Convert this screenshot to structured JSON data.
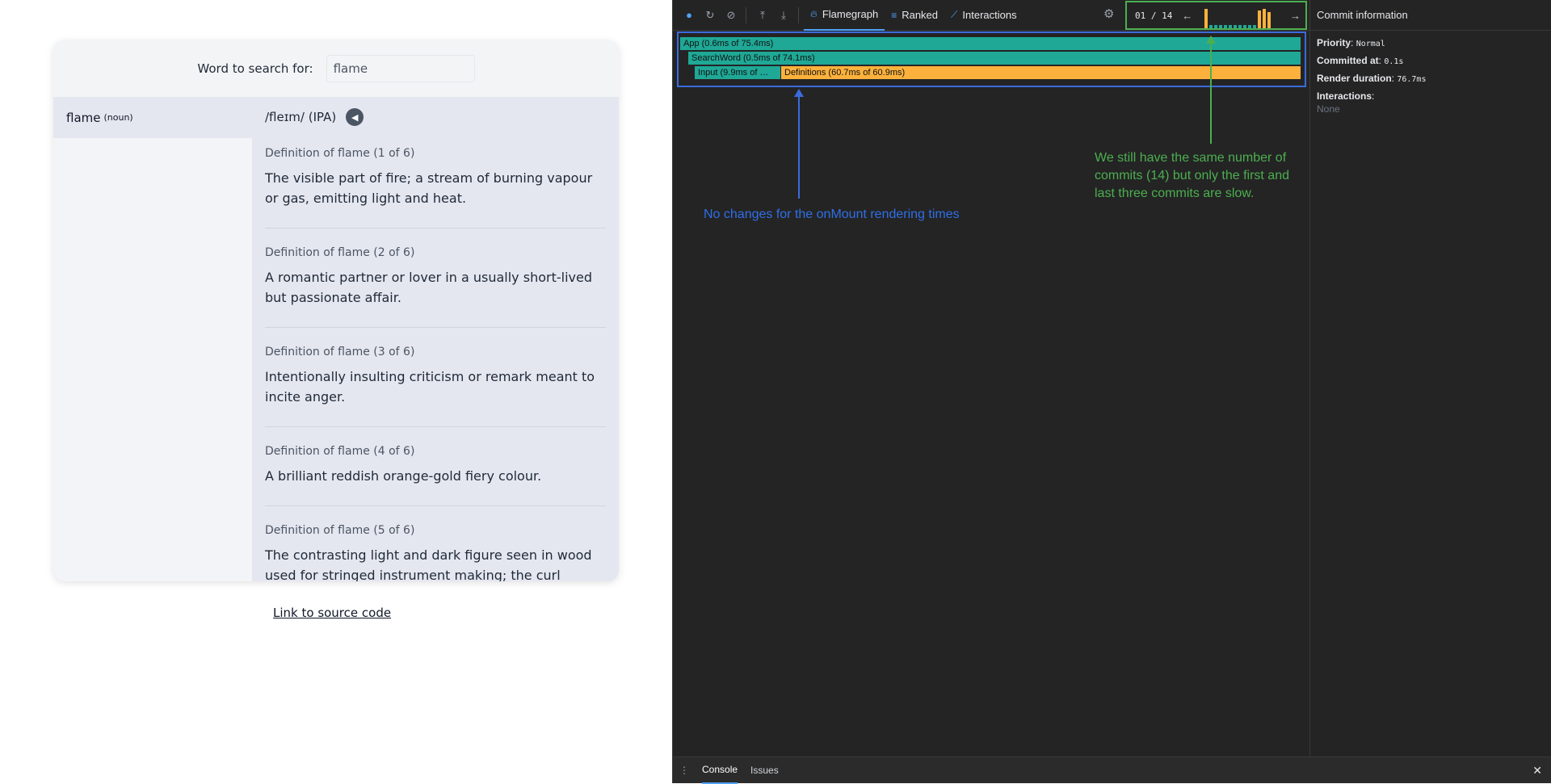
{
  "app": {
    "search_label": "Word to search for:",
    "search_value": "flame",
    "word": "flame",
    "word_pos": "(noun)",
    "phonetic": "/fleɪm/ (IPA)",
    "definitions": [
      {
        "head": "Definition of flame (1 of 6)",
        "text": "The visible part of fire; a stream of burning vapour or gas, emitting light and heat."
      },
      {
        "head": "Definition of flame (2 of 6)",
        "text": "A romantic partner or lover in a usually short-lived but passionate affair."
      },
      {
        "head": "Definition of flame (3 of 6)",
        "text": "Intentionally insulting criticism or remark meant to incite anger."
      },
      {
        "head": "Definition of flame (4 of 6)",
        "text": "A brilliant reddish orange-gold fiery colour."
      },
      {
        "head": "Definition of flame (5 of 6)",
        "text": "The contrasting light and dark figure seen in wood used for stringed instrument making; the curl"
      }
    ],
    "source_link": "Link to source code"
  },
  "devtools": {
    "tabs": [
      "Flamegraph",
      "Ranked",
      "Interactions"
    ],
    "commit_counter": "01 / 14",
    "flamegraph": {
      "app_bar": "App (0.6ms of 75.4ms)",
      "searchword_bar": "SearchWord (0.5ms of 74.1ms)",
      "input_bar": "Input (9.9ms of …",
      "definitions_bar": "Definitions (60.7ms of 60.9ms)"
    },
    "annotations": {
      "blue": "No changes for the onMount rendering times",
      "green": "We still have the same number of commits (14) but only the first and last three commits are slow."
    },
    "commit_info": {
      "title": "Commit information",
      "priority_label": "Priority",
      "priority_value": "Normal",
      "committed_label": "Committed at",
      "committed_value": "0.1s",
      "render_label": "Render duration",
      "render_value": "76.7ms",
      "interactions_label": "Interactions",
      "interactions_value": "None"
    },
    "console_tabs": [
      "Console",
      "Issues"
    ]
  },
  "colors": {
    "flame_teal": "#1fa896",
    "flame_orange": "#fbb13c",
    "annotation_blue": "#2f6fe8",
    "annotation_green": "#4caf50"
  }
}
